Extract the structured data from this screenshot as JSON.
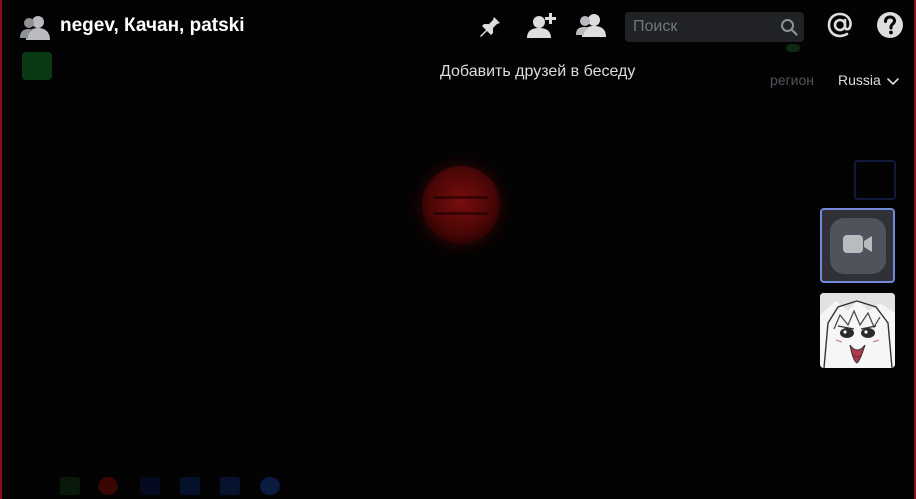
{
  "header": {
    "title": "negev, Качан, patski",
    "icons": {
      "group": "group-dm-icon",
      "pin": "pin-icon",
      "add_friend": "add-friend-icon",
      "members": "members-icon",
      "mention": "mention-icon",
      "help": "help-icon"
    },
    "search": {
      "placeholder": "Поиск",
      "value": "",
      "icon": "search-icon"
    }
  },
  "tooltip": {
    "text": "Добавить друзей в беседу"
  },
  "region": {
    "label": "регион",
    "value": "Russia"
  },
  "tiles": [
    {
      "kind": "camera-off",
      "icon": "camera-icon",
      "selected": true
    },
    {
      "kind": "avatar",
      "icon": "anime-avatar"
    }
  ],
  "colors": {
    "background": "#030303",
    "accent": "#7289da",
    "frame_border": "#8a0f14",
    "search_bg": "#202225",
    "tile_bg": "#2f3136"
  }
}
